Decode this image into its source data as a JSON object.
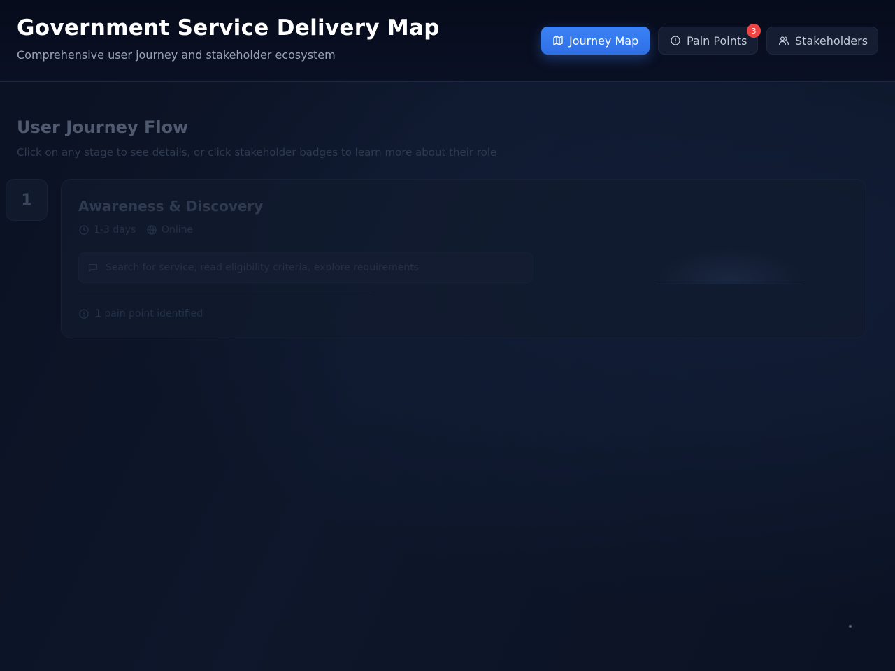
{
  "header": {
    "title": "Government Service Delivery Map",
    "subtitle": "Comprehensive user journey and stakeholder ecosystem",
    "tabs": [
      {
        "label": "Journey Map",
        "icon": "map-icon",
        "active": true
      },
      {
        "label": "Pain Points",
        "icon": "alert-circle-icon",
        "active": false,
        "badge": "3"
      },
      {
        "label": "Stakeholders",
        "icon": "users-icon",
        "active": false
      }
    ]
  },
  "journey": {
    "title": "User Journey Flow",
    "description": "Click on any stage to see details, or click stakeholder badges to learn more about their role",
    "stages": [
      {
        "number": "1",
        "title": "Awareness & Discovery",
        "duration": "1-3 days",
        "channel": "Online",
        "activity": "Search for service, read eligibility criteria, explore requirements",
        "pain_summary": "1 pain point identified"
      }
    ]
  },
  "colors": {
    "accent": "#3b82f6",
    "badge": "#ef4444",
    "background": "#0b1224"
  }
}
